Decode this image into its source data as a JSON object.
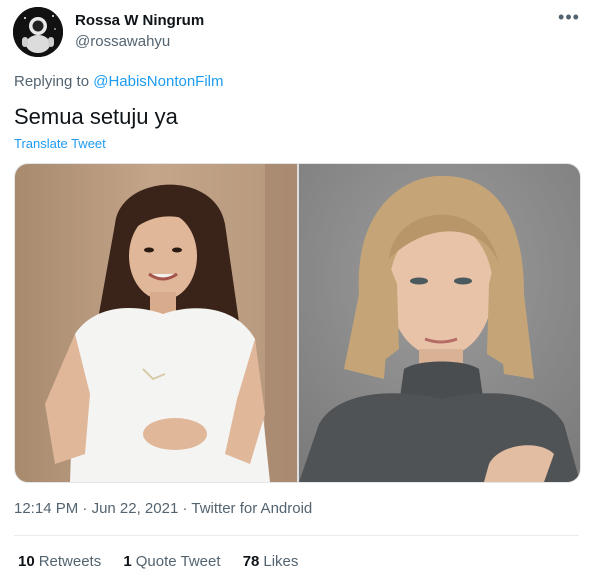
{
  "author": {
    "display_name": "Rossa W Ningrum",
    "handle": "@rossawahyu",
    "avatar_icon": "astronaut-avatar-icon"
  },
  "more_icon": "more-horizontal-icon",
  "reply": {
    "prefix": "Replying to ",
    "mention": "@HabisNontonFilm"
  },
  "tweet": {
    "text": "Semua setuju ya",
    "translate_label": "Translate Tweet"
  },
  "media": [
    {
      "name": "photo-left",
      "desc_icon": "photo-woman-dark-hair-white-tshirt"
    },
    {
      "name": "photo-right",
      "desc_icon": "photo-woman-blonde-gray-turtleneck"
    }
  ],
  "meta": {
    "time": "12:14 PM",
    "sep1": " · ",
    "date": "Jun 22, 2021",
    "sep2": " · ",
    "source": "Twitter for Android"
  },
  "stats": {
    "retweets_count": "10",
    "retweets_label": "Retweets",
    "quotes_count": "1",
    "quotes_label": "Quote Tweet",
    "likes_count": "78",
    "likes_label": "Likes"
  },
  "colors": {
    "accent": "#1d9bf0",
    "secondary_text": "#536471",
    "primary_text": "#0f1419"
  }
}
